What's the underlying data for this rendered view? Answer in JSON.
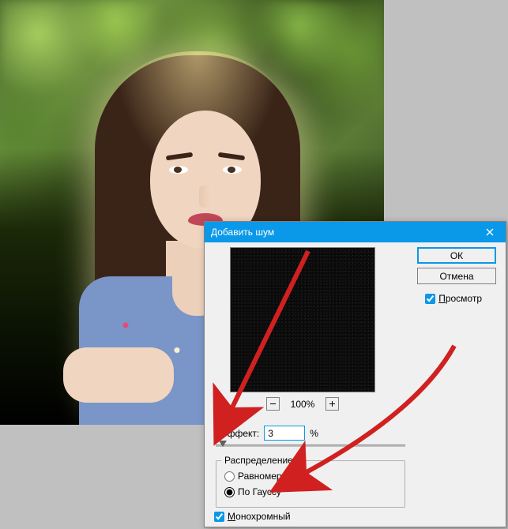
{
  "dialog": {
    "title": "Добавить шум",
    "ok_label": "ОК",
    "cancel_label": "Отмена",
    "preview_checkbox": "Просмотр",
    "zoom_value": "100%",
    "amount_label": "Эффект:",
    "amount_value": "3",
    "amount_unit": "%",
    "distribution": {
      "legend": "Распределение",
      "uniform": "Равномерная",
      "gaussian": "По Гауссу"
    },
    "mono_checkbox": "Монохромный"
  }
}
